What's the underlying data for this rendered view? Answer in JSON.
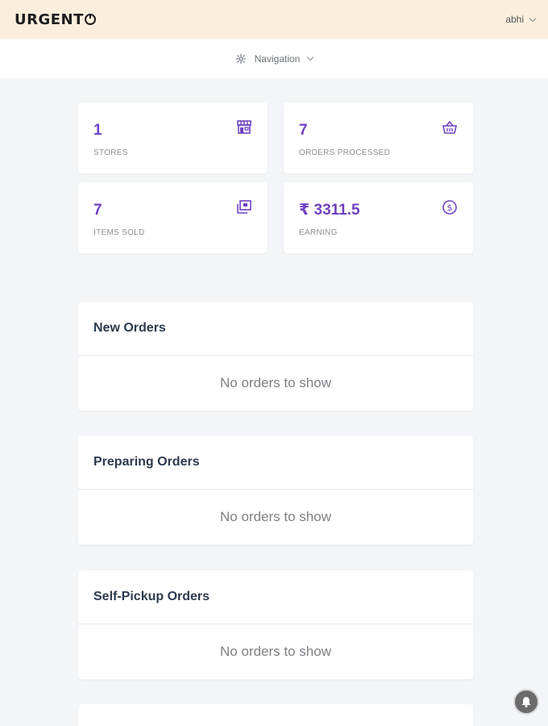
{
  "header": {
    "brand_prefix": "URGENT",
    "user_name": "abhi"
  },
  "nav": {
    "label": "Navigation"
  },
  "stats": [
    {
      "value": "1",
      "label": "STORES",
      "icon": "store-icon"
    },
    {
      "value": "7",
      "label": "ORDERS PROCESSED",
      "icon": "basket-icon"
    },
    {
      "value": "7",
      "label": "ITEMS SOLD",
      "icon": "items-icon"
    },
    {
      "value": "₹ 3311.5",
      "label": "EARNING",
      "icon": "dollar-icon"
    }
  ],
  "panels": [
    {
      "title": "New Orders",
      "empty_text": "No orders to show"
    },
    {
      "title": "Preparing Orders",
      "empty_text": "No orders to show"
    },
    {
      "title": "Self-Pickup Orders",
      "empty_text": "No orders to show"
    }
  ],
  "colors": {
    "accent": "#6f42c1",
    "header_bg": "#fbeedd",
    "page_bg": "#f4f5f8"
  }
}
